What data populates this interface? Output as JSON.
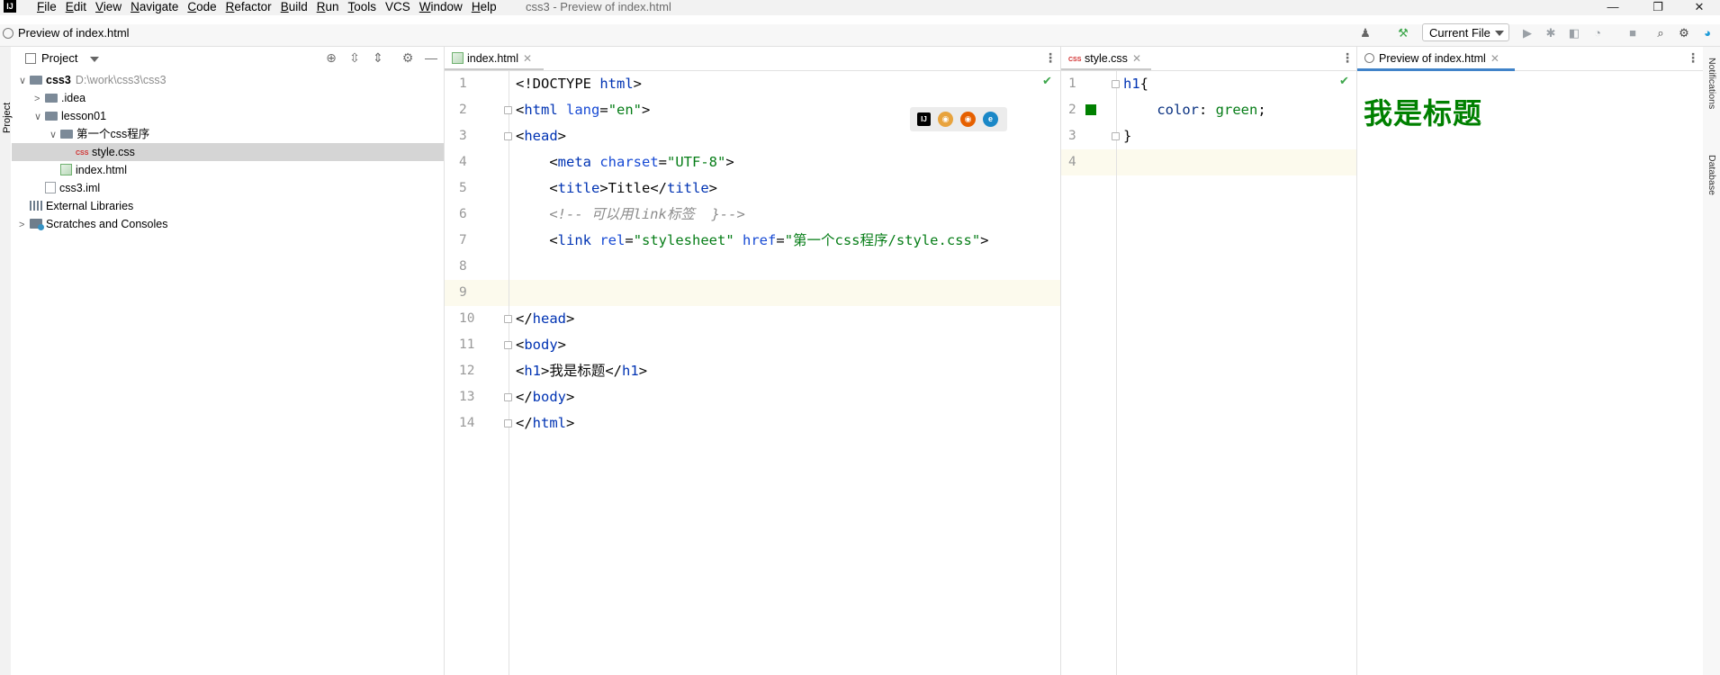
{
  "app": {
    "logo_text": "IJ",
    "window_title": "css3 - Preview of index.html",
    "menu": [
      {
        "hot": "F",
        "rest": "ile"
      },
      {
        "hot": "E",
        "rest": "dit"
      },
      {
        "hot": "V",
        "rest": "iew"
      },
      {
        "hot": "N",
        "rest": "avigate"
      },
      {
        "hot": "C",
        "rest": "ode"
      },
      {
        "hot": "R",
        "rest": "efactor"
      },
      {
        "hot": "B",
        "rest": "uild"
      },
      {
        "hot": "R",
        "rest": "un"
      },
      {
        "hot": "T",
        "rest": "ools"
      },
      {
        "hot": "",
        "rest": "VCS"
      },
      {
        "hot": "W",
        "rest": "indow"
      },
      {
        "hot": "H",
        "rest": "elp"
      }
    ],
    "window_controls": {
      "minimize": "—",
      "restore": "❐",
      "close": "✕"
    }
  },
  "navbar": {
    "breadcrumb": "Preview of index.html",
    "run_config": "Current File"
  },
  "stripes": {
    "left_label": "Project",
    "right_labels": [
      "Notifications",
      "Database"
    ]
  },
  "project": {
    "title": "Project",
    "tree": [
      {
        "depth": 0,
        "chev": "∨",
        "icon": "folder",
        "label": "css3",
        "extra": "D:\\work\\css3\\css3",
        "bold": true
      },
      {
        "depth": 1,
        "chev": ">",
        "icon": "folder",
        "label": ".idea"
      },
      {
        "depth": 1,
        "chev": "∨",
        "icon": "folder",
        "label": "lesson01"
      },
      {
        "depth": 2,
        "chev": "∨",
        "icon": "folder",
        "label": "第一个css程序"
      },
      {
        "depth": 3,
        "chev": "",
        "icon": "css",
        "label": "style.css",
        "selected": true
      },
      {
        "depth": 2,
        "chev": "",
        "icon": "html",
        "label": "index.html"
      },
      {
        "depth": 1,
        "chev": "",
        "icon": "iml",
        "label": "css3.iml"
      },
      {
        "depth": 0,
        "chev": "",
        "icon": "lib",
        "label": "External Libraries"
      },
      {
        "depth": 0,
        "chev": ">",
        "icon": "scratch",
        "label": "Scratches and Consoles"
      }
    ]
  },
  "editor_left": {
    "tab_label": "index.html",
    "line_numbers": [
      "1",
      "2",
      "3",
      "4",
      "5",
      "6",
      "7",
      "8",
      "9",
      "10",
      "11",
      "12",
      "13",
      "14"
    ],
    "lines": [
      [
        {
          "t": "<!DOCTYPE ",
          "c": ""
        },
        {
          "t": "html",
          "c": "tag"
        },
        {
          "t": ">",
          "c": ""
        }
      ],
      [
        {
          "t": "<",
          "c": ""
        },
        {
          "t": "html ",
          "c": "tag"
        },
        {
          "t": "lang",
          "c": "attr"
        },
        {
          "t": "=",
          "c": ""
        },
        {
          "t": "\"en\"",
          "c": "str"
        },
        {
          "t": ">",
          "c": ""
        }
      ],
      [
        {
          "t": "<",
          "c": ""
        },
        {
          "t": "head",
          "c": "tag"
        },
        {
          "t": ">",
          "c": ""
        }
      ],
      [
        {
          "t": "    <",
          "c": ""
        },
        {
          "t": "meta ",
          "c": "tag"
        },
        {
          "t": "charset",
          "c": "attr"
        },
        {
          "t": "=",
          "c": ""
        },
        {
          "t": "\"UTF-8\"",
          "c": "str"
        },
        {
          "t": ">",
          "c": ""
        }
      ],
      [
        {
          "t": "    <",
          "c": ""
        },
        {
          "t": "title",
          "c": "tag"
        },
        {
          "t": ">Title</",
          "c": ""
        },
        {
          "t": "title",
          "c": "tag"
        },
        {
          "t": ">",
          "c": ""
        }
      ],
      [
        {
          "t": "    <!-- 可以用link标签  }-->",
          "c": "cmt"
        }
      ],
      [
        {
          "t": "    <",
          "c": ""
        },
        {
          "t": "link ",
          "c": "tag"
        },
        {
          "t": "rel",
          "c": "attr"
        },
        {
          "t": "=",
          "c": ""
        },
        {
          "t": "\"stylesheet\" ",
          "c": "str"
        },
        {
          "t": "href",
          "c": "attr"
        },
        {
          "t": "=",
          "c": ""
        },
        {
          "t": "\"第一个css程序/style.css\"",
          "c": "str"
        },
        {
          "t": ">",
          "c": ""
        }
      ],
      [
        {
          "t": "",
          "c": ""
        }
      ],
      [
        {
          "t": "",
          "c": ""
        }
      ],
      [
        {
          "t": "</",
          "c": ""
        },
        {
          "t": "head",
          "c": "tag"
        },
        {
          "t": ">",
          "c": ""
        }
      ],
      [
        {
          "t": "<",
          "c": ""
        },
        {
          "t": "body",
          "c": "tag"
        },
        {
          "t": ">",
          "c": ""
        }
      ],
      [
        {
          "t": "<",
          "c": ""
        },
        {
          "t": "h1",
          "c": "tag"
        },
        {
          "t": ">我是标题</",
          "c": ""
        },
        {
          "t": "h1",
          "c": "tag"
        },
        {
          "t": ">",
          "c": ""
        }
      ],
      [
        {
          "t": "</",
          "c": ""
        },
        {
          "t": "body",
          "c": "tag"
        },
        {
          "t": ">",
          "c": ""
        }
      ],
      [
        {
          "t": "</",
          "c": ""
        },
        {
          "t": "html",
          "c": "tag"
        },
        {
          "t": ">",
          "c": ""
        }
      ]
    ],
    "browsers": [
      {
        "name": "intellij-browser-icon",
        "glyph": "IJ",
        "color": "#000000"
      },
      {
        "name": "chrome-icon",
        "glyph": "◉",
        "color": "#e8a33d"
      },
      {
        "name": "firefox-icon",
        "glyph": "◉",
        "color": "#e66000"
      },
      {
        "name": "edge-icon",
        "glyph": "e",
        "color": "#1b88c7"
      }
    ]
  },
  "editor_right": {
    "tab_label": "style.css",
    "line_numbers": [
      "1",
      "2",
      "3",
      "4"
    ],
    "lines": [
      [
        {
          "t": "h1",
          "c": "sel"
        },
        {
          "t": "{",
          "c": ""
        }
      ],
      [
        {
          "t": "    ",
          "c": ""
        },
        {
          "t": "color",
          "c": "prop"
        },
        {
          "t": ": ",
          "c": ""
        },
        {
          "t": "green",
          "c": "val"
        },
        {
          "t": ";",
          "c": ""
        }
      ],
      [
        {
          "t": "}",
          "c": ""
        }
      ],
      [
        {
          "t": "",
          "c": ""
        }
      ]
    ],
    "swatch_color": "#008000"
  },
  "preview": {
    "tab_label": "Preview of index.html",
    "h1": "我是标题",
    "h1_color": "#008000"
  }
}
